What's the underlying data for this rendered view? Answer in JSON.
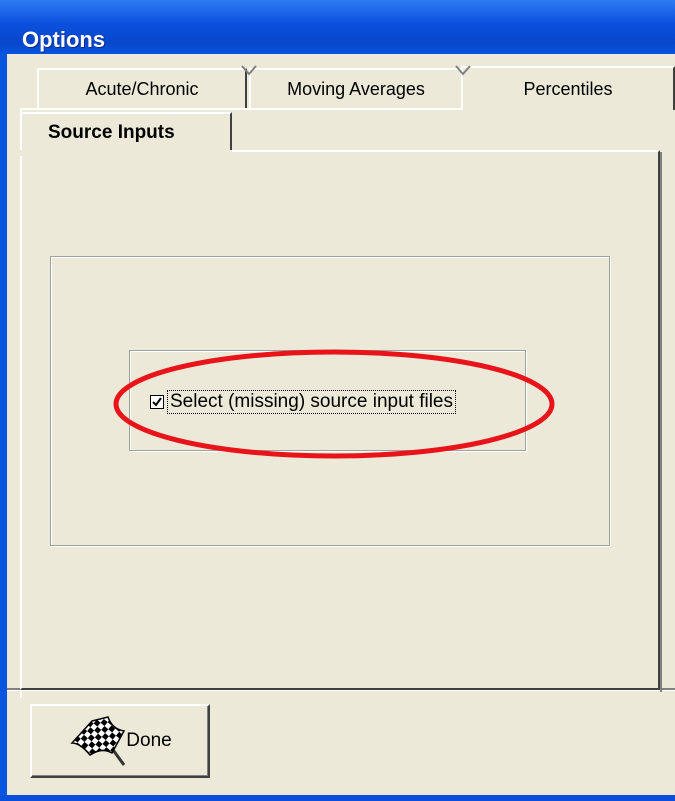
{
  "window": {
    "title": "Options"
  },
  "tabs": {
    "row_back": [
      {
        "label": "Acute/Chronic"
      },
      {
        "label": "Moving Averages"
      },
      {
        "label": "Percentiles"
      }
    ],
    "active": {
      "label": "Source Inputs"
    }
  },
  "source_inputs": {
    "checkbox_label": "Select (missing) source input files",
    "checkbox_checked": true
  },
  "buttons": {
    "done_label": "Done"
  },
  "icons": {
    "done": "checkered-flag-icon"
  },
  "colors": {
    "titlebar": "#0a4fdc",
    "face": "#ece9d8",
    "highlight_ellipse": "#e8141a",
    "outer_background": "#f7d79a"
  }
}
